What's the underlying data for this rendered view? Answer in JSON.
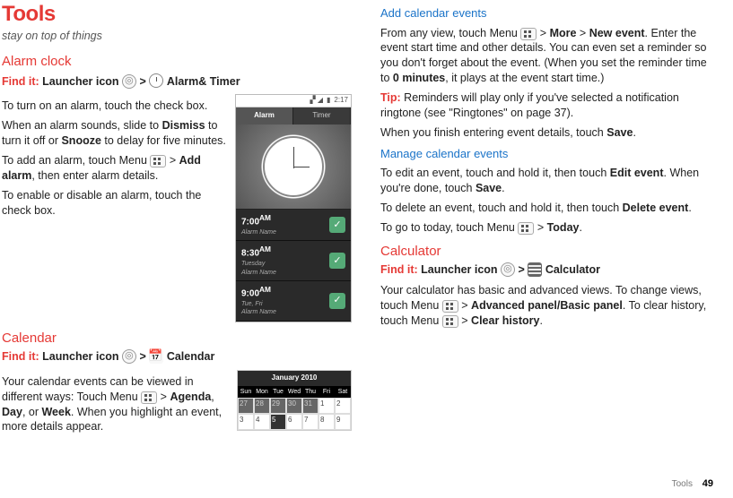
{
  "page": {
    "footer_label": "Tools",
    "page_num": "49"
  },
  "left": {
    "title": "Tools",
    "subtitle": "stay on top of things",
    "alarm": {
      "heading": "Alarm clock",
      "find_prefix": "Find it:",
      "find_path1": "Launcher icon",
      "find_path2": "Alarm& Timer",
      "p1a": "To turn on an alarm, touch the check box.",
      "p2": "When an alarm sounds, slide to ",
      "p2b1": "Dismiss",
      "p2m": " to turn it off or ",
      "p2b2": "Snooze",
      "p2e": " to delay for five minutes.",
      "p3a": "To add an alarm, touch Menu ",
      "p3b": "Add alarm",
      "p3c": ", then enter alarm details.",
      "p4": "To enable or disable an alarm, touch the check box."
    },
    "calendar": {
      "heading": "Calendar",
      "find_prefix": "Find it:",
      "find_path1": "Launcher icon",
      "find_path2": "Calendar",
      "p1a": "Your calendar events can be viewed in different ways: Touch Menu ",
      "p1b1": "Agenda",
      "p1m1": ", ",
      "p1b2": "Day",
      "p1m2": ", or ",
      "p1b3": "Week",
      "p1e": ". When you highlight an event, more details appear."
    },
    "phone": {
      "time": "2:17",
      "tab_alarm": "Alarm",
      "tab_timer": "Timer",
      "rows": [
        {
          "time": "7:00",
          "ampm": "AM",
          "sub": "Alarm Name"
        },
        {
          "time": "8:30",
          "ampm": "AM",
          "sub": "Tuesday\nAlarm Name"
        },
        {
          "time": "9:00",
          "ampm": "AM",
          "sub": "Tue, Fri\nAlarm Name"
        }
      ]
    },
    "calmock": {
      "title": "January 2010",
      "days": [
        "Sun",
        "Mon",
        "Tue",
        "Wed",
        "Thu",
        "Fri",
        "Sat"
      ],
      "row1": [
        "27",
        "28",
        "29",
        "30",
        "31",
        "1",
        "2"
      ],
      "row2": [
        "3",
        "4",
        "5",
        "6",
        "7",
        "8",
        "9"
      ]
    }
  },
  "right": {
    "add": {
      "heading": "Add calendar events",
      "p1a": "From any view, touch Menu ",
      "p1b1": "More",
      "p1m": " > ",
      "p1b2": "New event",
      "p1c": ". Enter the event start time and other details. You can even set a reminder so you don't forget about the event. (When you set the reminder time to ",
      "p1b3": "0 minutes",
      "p1d": ", it plays at the event start time.)",
      "tip_label": "Tip:",
      "tip_text": " Reminders will play only if you've selected a notification ringtone (see \"Ringtones\" on page 37).",
      "p3a": "When you finish entering event details, touch ",
      "p3b": "Save",
      "p3c": "."
    },
    "manage": {
      "heading": "Manage calendar events",
      "p1a": "To edit an event, touch and hold it, then touch ",
      "p1b": "Edit event",
      "p1c": ". When you're done, touch ",
      "p1d": "Save",
      "p1e": ".",
      "p2a": "To delete an event, touch and hold it, then touch ",
      "p2b": "Delete event",
      "p2c": ".",
      "p3a": "To go to today, touch Menu ",
      "p3b": "Today",
      "p3c": "."
    },
    "calc": {
      "heading": "Calculator",
      "find_prefix": "Find it:",
      "find_path1": "Launcher icon",
      "find_path2": "Calculator",
      "p1a": "Your calculator has basic and advanced views. To change views, touch Menu ",
      "p1b1": "Advanced panel/Basic panel",
      "p1m": ". To clear history, touch Menu ",
      "p1b2": "Clear history",
      "p1e": "."
    }
  }
}
